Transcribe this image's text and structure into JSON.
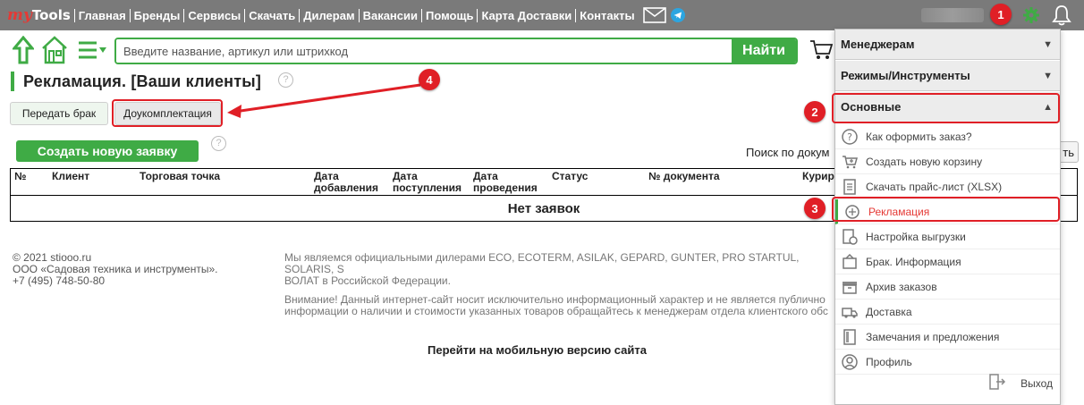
{
  "topbar": {
    "logo_my": "my",
    "logo_tools": "Tools",
    "nav": [
      "Главная",
      "Бренды",
      "Сервисы",
      "Скачать",
      "Дилерам",
      "Вакансии",
      "Помощь",
      "Карта Доставки",
      "Контакты"
    ]
  },
  "search": {
    "placeholder": "Введите название, артикул или штрихкод",
    "button": "Найти"
  },
  "page": {
    "title": "Рекламация. [Ваши клиенты]",
    "help": "?",
    "tab_defect": "Передать брак",
    "tab_complete": "Доукомплектация",
    "create_button": "Создать новую заявку",
    "search_doc_label": "Поиск по докум",
    "search_doc_button": "ть"
  },
  "table": {
    "headers": [
      "№",
      "Клиент",
      "Торговая точка",
      "Дата\nдобавления",
      "Дата\nпоступления",
      "Дата\nпроведения",
      "Статус",
      "№ документа",
      "Курир"
    ],
    "empty": "Нет заявок"
  },
  "footer": {
    "left": [
      "© 2021 stiooo.ru",
      "ООО «Садовая техника и инструменты».",
      "+7 (495) 748-50-80"
    ],
    "mid1": "Мы являемся официальными дилерами ECO, ECOTERM, ASILAK, GEPARD, GUNTER, PRO STARTUL, SOLARIS, S",
    "mid1b": "ВОЛАТ в Российской Федерации.",
    "mid2": "Внимание! Данный интернет-сайт носит исключительно информационный характер и не является публично",
    "mid2b": "информации о наличии и стоимости указанных товаров обращайтесь к менеджерам отдела клиентского обс",
    "mobile": "Перейти на мобильную версию сайта"
  },
  "dropdown": {
    "sections": [
      "Менеджерам",
      "Режимы/Инструменты",
      "Основные"
    ],
    "items": [
      {
        "label": "Как оформить заказ?",
        "icon": "question-circle-icon"
      },
      {
        "label": "Создать новую корзину",
        "icon": "cart-plus-icon"
      },
      {
        "label": "Скачать прайс-лист (XLSX)",
        "icon": "document-icon"
      },
      {
        "label": "Рекламация",
        "icon": "reclamation-icon"
      },
      {
        "label": "Настройка выгрузки",
        "icon": "export-settings-icon"
      },
      {
        "label": "Брак. Информация",
        "icon": "defect-info-icon"
      },
      {
        "label": "Архив заказов",
        "icon": "archive-icon"
      },
      {
        "label": "Доставка",
        "icon": "truck-icon"
      },
      {
        "label": "Замечания и предложения",
        "icon": "feedback-icon"
      },
      {
        "label": "Профиль",
        "icon": "profile-icon"
      }
    ],
    "exit": "Выход"
  },
  "annotations": [
    "1",
    "2",
    "3",
    "4"
  ],
  "colors": {
    "accent": "#3fab45",
    "topbar": "#7a7a7a",
    "annotation": "#e01f26"
  }
}
